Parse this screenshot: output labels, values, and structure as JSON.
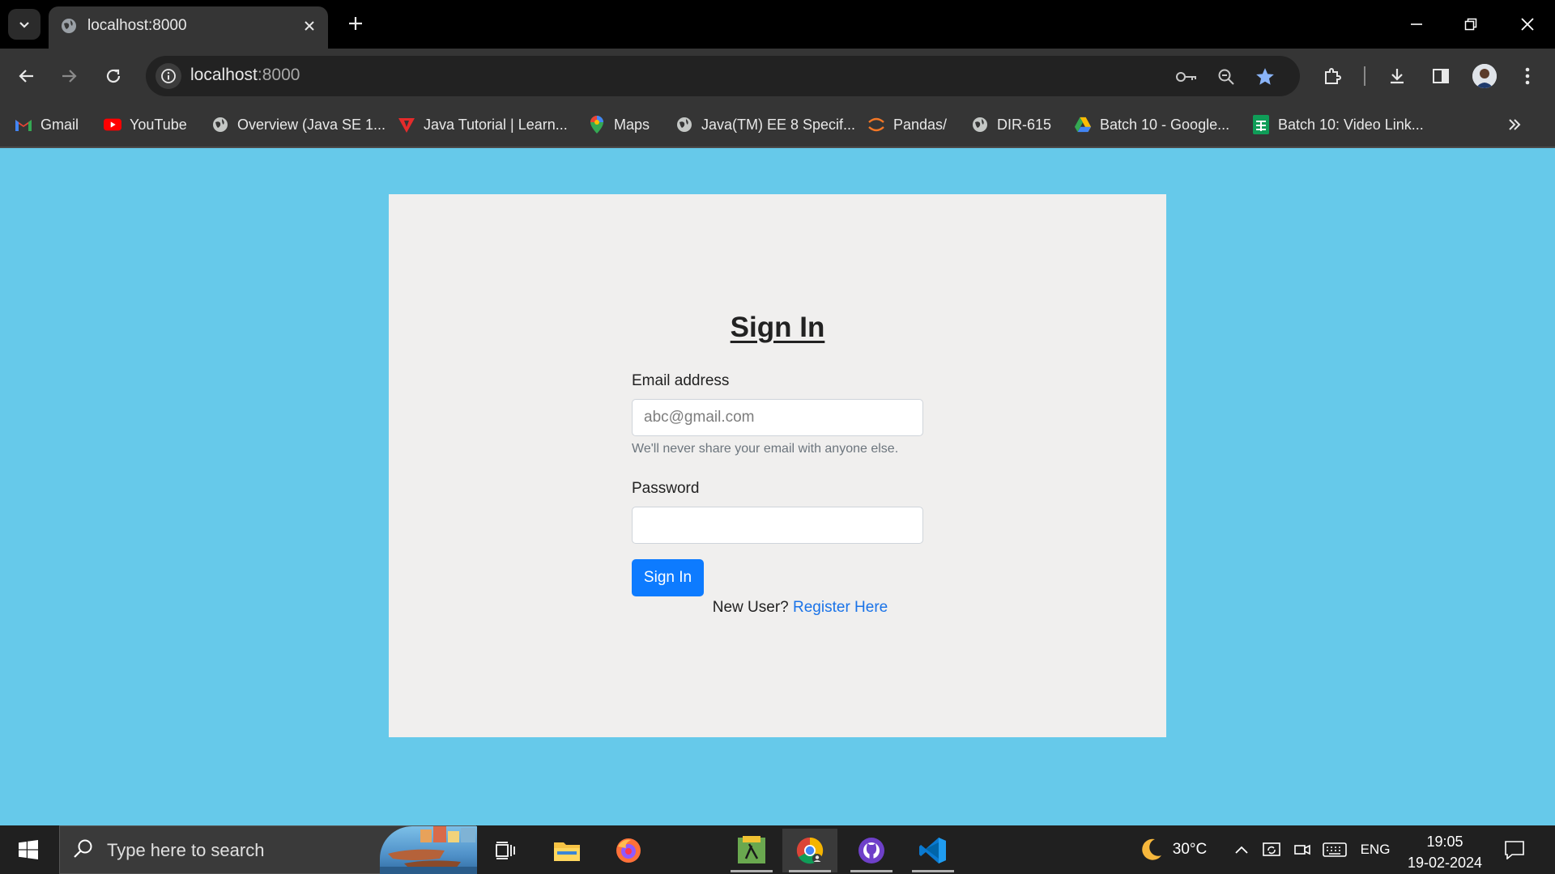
{
  "browser": {
    "tab_title": "localhost:8000",
    "url_host": "localhost",
    "url_port": ":8000",
    "bookmarks": [
      {
        "label": "Gmail",
        "icon": "gmail-icon"
      },
      {
        "label": "YouTube",
        "icon": "youtube-icon"
      },
      {
        "label": "Overview (Java SE 1...",
        "icon": "globe-icon"
      },
      {
        "label": "Java Tutorial | Learn...",
        "icon": "tutorial-icon"
      },
      {
        "label": "Maps",
        "icon": "maps-icon"
      },
      {
        "label": "Java(TM) EE 8 Specif...",
        "icon": "globe-icon"
      },
      {
        "label": "Pandas/",
        "icon": "jupyter-icon"
      },
      {
        "label": "DIR-615",
        "icon": "globe-icon"
      },
      {
        "label": "Batch 10 - Google...",
        "icon": "drive-icon"
      },
      {
        "label": "Batch 10: Video Link...",
        "icon": "sheets-icon"
      }
    ]
  },
  "signin": {
    "title": "Sign In",
    "email_label": "Email address",
    "email_placeholder": "abc@gmail.com",
    "email_value": "",
    "email_hint": "We'll never share your email with anyone else.",
    "password_label": "Password",
    "password_value": "",
    "submit_label": "Sign In",
    "new_user_text": "New User?",
    "register_link": "Register Here"
  },
  "taskbar": {
    "search_placeholder": "Type here to search",
    "weather_temp": "30°C",
    "language": "ENG",
    "time": "19:05",
    "date": "19-02-2024"
  },
  "colors": {
    "page_background": "#66c9ea",
    "card_background": "#f0efee",
    "primary_button": "#0d7bff",
    "link": "#1a73e8"
  }
}
